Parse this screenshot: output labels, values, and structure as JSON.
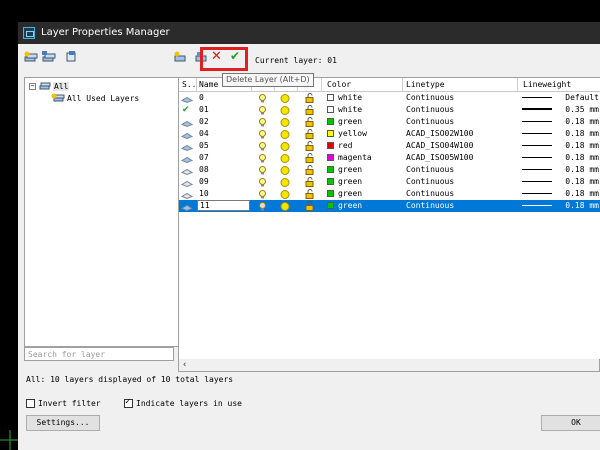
{
  "window": {
    "title": "Layer Properties Manager"
  },
  "toolbar": {
    "current_layer_label": "Current layer: 01",
    "delete_tooltip": "Delete Layer (Alt+D)"
  },
  "tree": {
    "root": "All",
    "child": "All Used Layers"
  },
  "grid": {
    "headers": [
      "S..",
      "Name",
      "",
      "",
      "",
      "Color",
      "Linetype",
      "Lineweight"
    ],
    "rows": [
      {
        "name": "0",
        "color_name": "white",
        "color": "#ffffff",
        "linetype": "Continuous",
        "lineweight": "Default",
        "status": "layer"
      },
      {
        "name": "01",
        "color_name": "white",
        "color": "#ffffff",
        "linetype": "Continuous",
        "lineweight": "0.35 mm",
        "status": "current"
      },
      {
        "name": "02",
        "color_name": "green",
        "color": "#00c800",
        "linetype": "Continuous",
        "lineweight": "0.18 mm",
        "status": "layer"
      },
      {
        "name": "04",
        "color_name": "yellow",
        "color": "#ffff00",
        "linetype": "ACAD_ISO02W100",
        "lineweight": "0.18 mm",
        "status": "layer"
      },
      {
        "name": "05",
        "color_name": "red",
        "color": "#e00000",
        "linetype": "ACAD_ISO04W100",
        "lineweight": "0.18 mm",
        "status": "layer"
      },
      {
        "name": "07",
        "color_name": "magenta",
        "color": "#e000e0",
        "linetype": "ACAD_ISO05W100",
        "lineweight": "0.18 mm",
        "status": "layer"
      },
      {
        "name": "08",
        "color_name": "green",
        "color": "#00c800",
        "linetype": "Continuous",
        "lineweight": "0.18 mm",
        "status": "unused"
      },
      {
        "name": "09",
        "color_name": "green",
        "color": "#00c800",
        "linetype": "Continuous",
        "lineweight": "0.18 mm",
        "status": "unused"
      },
      {
        "name": "10",
        "color_name": "green",
        "color": "#00c800",
        "linetype": "Continuous",
        "lineweight": "0.18 mm",
        "status": "unused"
      },
      {
        "name": "11",
        "color_name": "green",
        "color": "#00c800",
        "linetype": "Continuous",
        "lineweight": "0.18 mm",
        "status": "selected"
      }
    ]
  },
  "search": {
    "placeholder": "Search for layer"
  },
  "status": {
    "text": "All: 10 layers displayed of 10 total layers"
  },
  "options": {
    "invert_filter": "Invert filter",
    "indicate_layers": "Indicate layers in use"
  },
  "buttons": {
    "settings": "Settings...",
    "ok": "OK"
  },
  "colors": {
    "selection": "#0078d7",
    "highlight": "#e02020",
    "titlebar": "#2b2b2b"
  }
}
